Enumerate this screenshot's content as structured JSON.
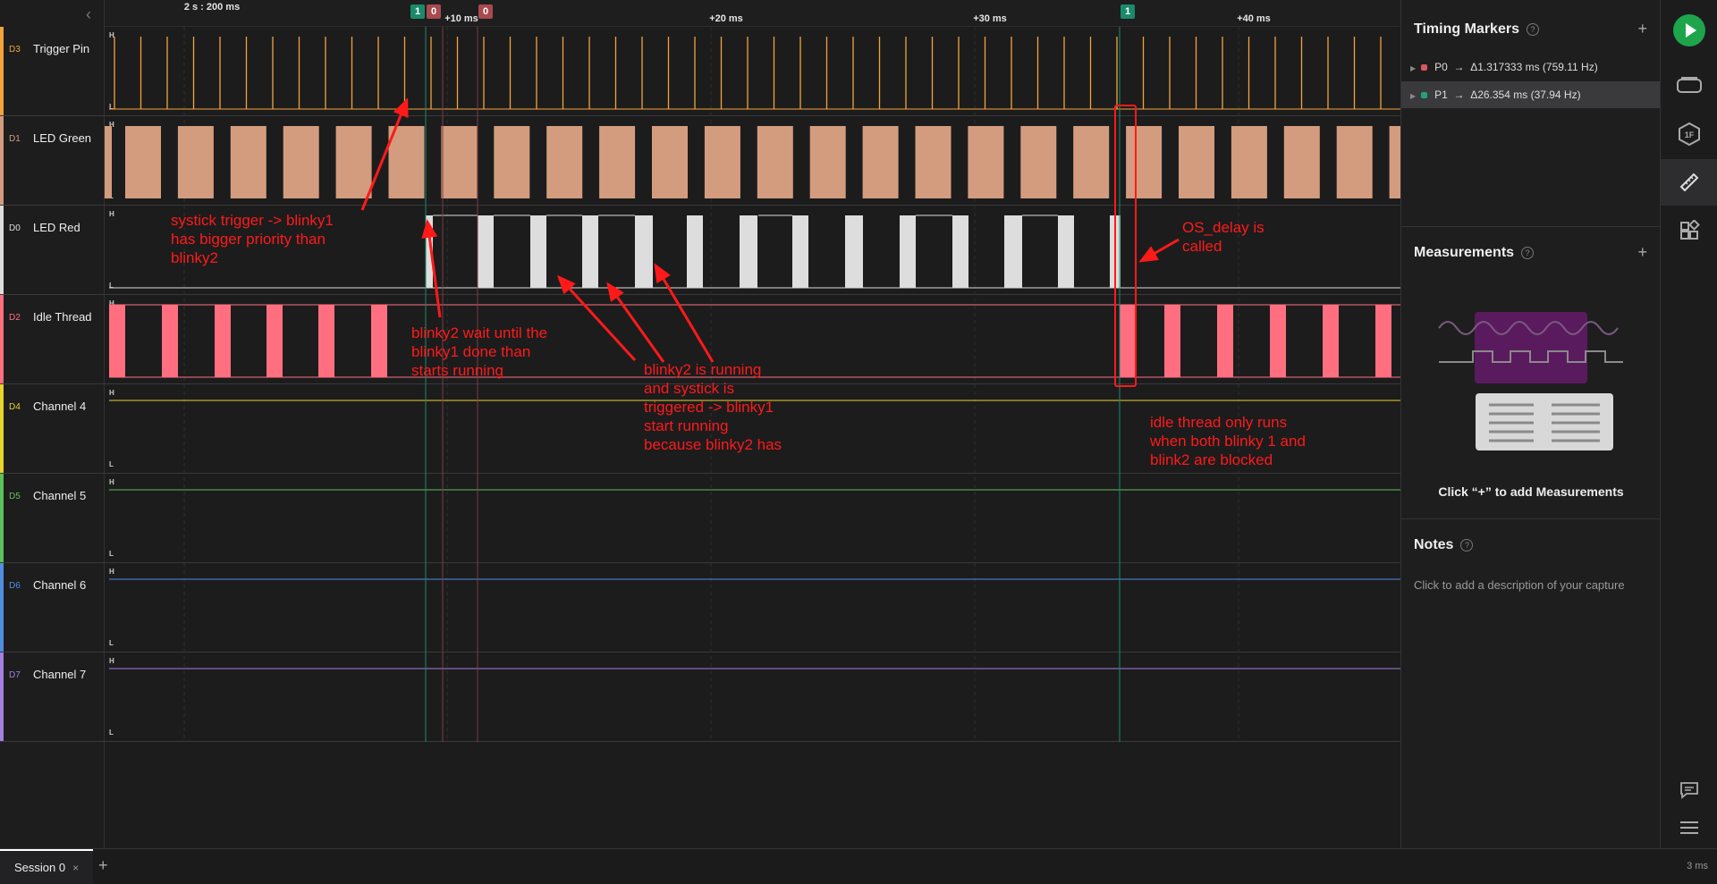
{
  "ruler": {
    "scale_label": "2 s : 200 ms",
    "ticks": [
      "+10 ms",
      "+20 ms",
      "+30 ms",
      "+40 ms"
    ],
    "flags": [
      "1",
      "0",
      "0",
      "1"
    ]
  },
  "channels": [
    {
      "id": "D3",
      "name": "Trigger Pin",
      "color": "#f2a33a"
    },
    {
      "id": "D1",
      "name": "LED Green",
      "color": "#d49c7e"
    },
    {
      "id": "D0",
      "name": "LED Red",
      "color": "#dddddd"
    },
    {
      "id": "D2",
      "name": "Idle Thread",
      "color": "#ff6f80"
    },
    {
      "id": "D4",
      "name": "Channel 4",
      "color": "#e8d22c"
    },
    {
      "id": "D5",
      "name": "Channel 5",
      "color": "#5bc15b"
    },
    {
      "id": "D6",
      "name": "Channel 6",
      "color": "#4f8fe0"
    },
    {
      "id": "D7",
      "name": "Channel 7",
      "color": "#a57fe0"
    }
  ],
  "level_labels": {
    "high": "H",
    "low": "L"
  },
  "annotations": {
    "a1": [
      "systick trigger -> blinky1",
      "has bigger priority than",
      "blinky2"
    ],
    "a2": [
      "blinky2 wait until the",
      "blinky1 done than",
      "starts running"
    ],
    "a3": [
      "blinky2 is running",
      "and systick is",
      "triggered -> blinky1",
      "start running",
      "because blinky2 has"
    ],
    "a4": [
      "OS_delay is",
      "called"
    ],
    "a5": [
      "idle thread only runs",
      "when both blinky 1 and",
      "blink2 are blocked"
    ]
  },
  "panel": {
    "timing_title": "Timing Markers",
    "markers": [
      {
        "name": "P0",
        "arrow": "→",
        "value": "Δ1.317333 ms (759.11 Hz)",
        "color": "#d9585f"
      },
      {
        "name": "P1",
        "arrow": "→",
        "value": "Δ26.354 ms (37.94 Hz)",
        "color": "#25a07e"
      }
    ],
    "measurements_title": "Measurements",
    "measurements_hint": "Click “+” to add Measurements",
    "notes_title": "Notes",
    "notes_placeholder": "Click to add a description of your capture",
    "help_glyph": "?",
    "plus_glyph": "+"
  },
  "iconbar": [
    "play-icon",
    "device-icon",
    "analyzer-icon",
    "ruler-icon",
    "extensions-icon",
    "chat-icon",
    "menu-icon"
  ],
  "bottom": {
    "session_label": "Session 0",
    "close_glyph": "×",
    "add_glyph": "+",
    "zoom": "3 ms"
  },
  "collapse_glyph": "‹"
}
